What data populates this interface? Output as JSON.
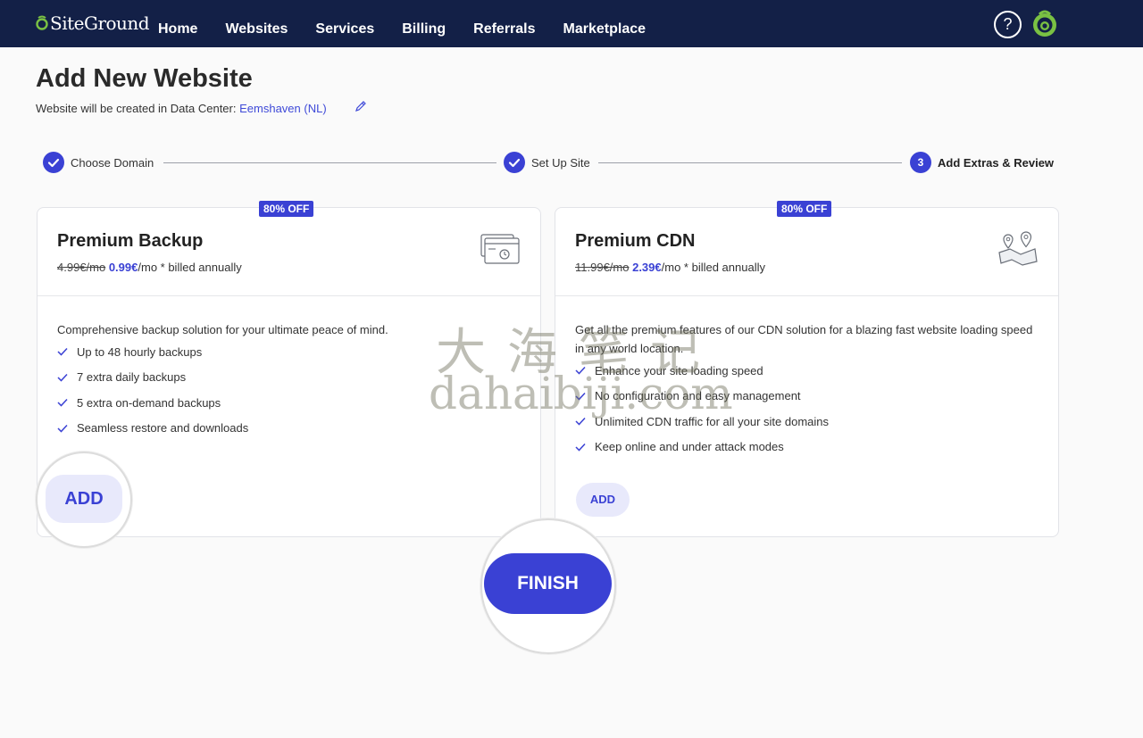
{
  "nav": {
    "logo": "SiteGround",
    "items": [
      "Home",
      "Websites",
      "Services",
      "Billing",
      "Referrals",
      "Marketplace"
    ],
    "help_label": "?"
  },
  "header": {
    "title": "Add New Website",
    "subtitle_prefix": "Website will be created in Data Center:",
    "data_center": "Eemshaven (NL)"
  },
  "stepper": {
    "steps": [
      {
        "label": "Choose Domain",
        "status": "done"
      },
      {
        "label": "Set Up Site",
        "status": "done"
      },
      {
        "label": "Add Extras & Review",
        "number": "3",
        "status": "active"
      }
    ]
  },
  "cards": [
    {
      "badge": "80% OFF",
      "title": "Premium Backup",
      "old_price": "4.99€/mo",
      "new_price": "0.99€",
      "price_suffix": "/mo * billed annually",
      "icon": "backup-calendar-icon",
      "description": "Comprehensive backup solution for your ultimate peace of mind.",
      "features": [
        "Up to 48 hourly backups",
        "7 extra daily backups",
        "5 extra on-demand backups",
        "Seamless restore and downloads"
      ],
      "button": "ADD"
    },
    {
      "badge": "80% OFF",
      "title": "Premium CDN",
      "old_price": "11.99€/mo",
      "new_price": "2.39€",
      "price_suffix": "/mo * billed annually",
      "icon": "map-pins-icon",
      "description": "Get all the premium features of our CDN solution for a blazing fast website loading speed in any world location.",
      "features": [
        "Enhance your site loading speed",
        "No configuration and easy management",
        "Unlimited CDN traffic for all your site domains",
        "Keep online and under attack modes"
      ],
      "button": "ADD"
    }
  ],
  "finish_button": "FINISH",
  "watermark": {
    "line1": "大海笔记",
    "line2": "dahaibiji.com"
  },
  "colors": {
    "nav_bg": "#132047",
    "accent": "#3a41d4",
    "add_bg": "#e8e9fb"
  }
}
